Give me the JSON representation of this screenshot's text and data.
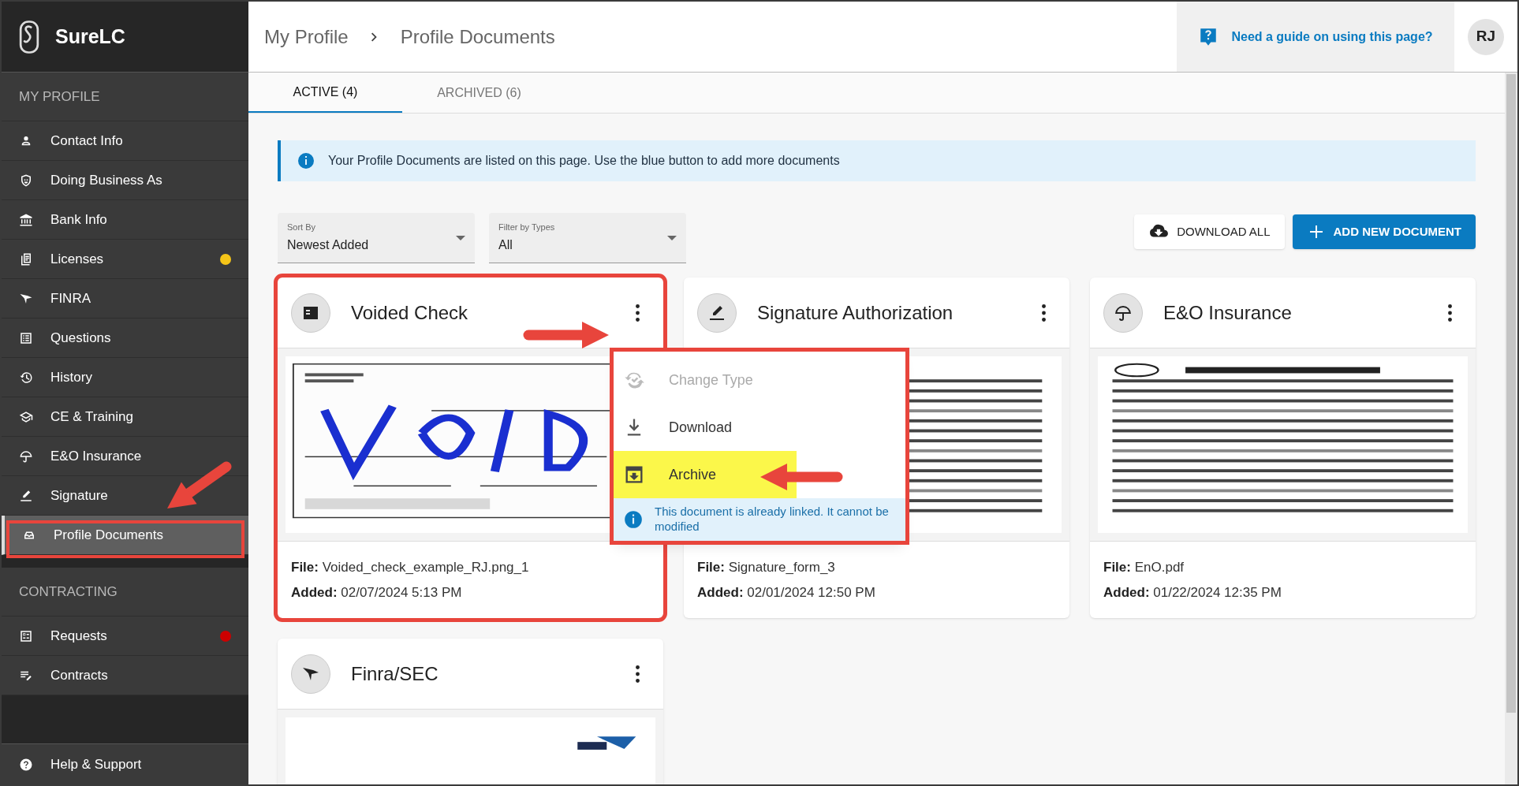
{
  "app": {
    "name": "SureLC"
  },
  "sidebar": {
    "sections": [
      {
        "title": "MY PROFILE",
        "items": [
          {
            "label": "Contact Info",
            "selected": false
          },
          {
            "label": "Doing Business As",
            "selected": false
          },
          {
            "label": "Bank Info",
            "selected": false
          },
          {
            "label": "Licenses",
            "selected": false,
            "color": "#f5c518"
          },
          {
            "label": "FINRA",
            "selected": false
          },
          {
            "label": "Questions",
            "selected": false
          },
          {
            "label": "History",
            "selected": false
          },
          {
            "label": "CE & Training",
            "selected": false
          },
          {
            "label": "E&O Insurance",
            "selected": false
          },
          {
            "label": "Signature",
            "selected": false
          },
          {
            "label": "Profile Documents",
            "selected": true
          }
        ]
      },
      {
        "title": "CONTRACTING",
        "items": [
          {
            "label": "Requests",
            "selected": false,
            "color": "#cc0000"
          },
          {
            "label": "Contracts",
            "selected": false
          }
        ]
      }
    ],
    "footer": {
      "label": "Help & Support"
    }
  },
  "header": {
    "breadcrumb": [
      "My Profile",
      "Profile Documents"
    ],
    "guide_link": "Need a guide on using this page?",
    "avatar": "RJ"
  },
  "tabs": [
    {
      "label": "ACTIVE (4)",
      "selected": true
    },
    {
      "label": "ARCHIVED (6)",
      "selected": false
    }
  ],
  "info_banner": "Your Profile Documents are listed on this page. Use the blue button to add more documents",
  "filters": [
    {
      "label": "Sort By",
      "value": "Newest Added"
    },
    {
      "label": "Filter by Types",
      "value": "All"
    }
  ],
  "buttons": [
    {
      "label": "DOWNLOAD ALL",
      "kind": "download"
    },
    {
      "label": "ADD NEW DOCUMENT",
      "kind": "add"
    }
  ],
  "cards": [
    {
      "title": "Voided Check",
      "file_label": "File:",
      "file": "Voided_check_example_RJ.png_1",
      "added_label": "Added:",
      "added": "02/07/2024 5:13 PM",
      "highlighted": true
    },
    {
      "title": "Signature Authorization",
      "file_label": "File:",
      "file": "Signature_form_3",
      "added_label": "Added:",
      "added": "02/01/2024 12:50 PM",
      "highlighted": false
    },
    {
      "title": "E&O Insurance",
      "file_label": "File:",
      "file": "EnO.pdf",
      "added_label": "Added:",
      "added": "01/22/2024 12:35 PM",
      "highlighted": false
    },
    {
      "title": "Finra/SEC",
      "highlighted": false
    }
  ],
  "context_menu": {
    "items": [
      {
        "label": "Change Type",
        "disabled": true,
        "selected": false
      },
      {
        "label": "Download",
        "disabled": false,
        "selected": false
      },
      {
        "label": "Archive",
        "disabled": false,
        "selected": true
      }
    ],
    "note": "This document is already linked. It cannot be modified"
  }
}
